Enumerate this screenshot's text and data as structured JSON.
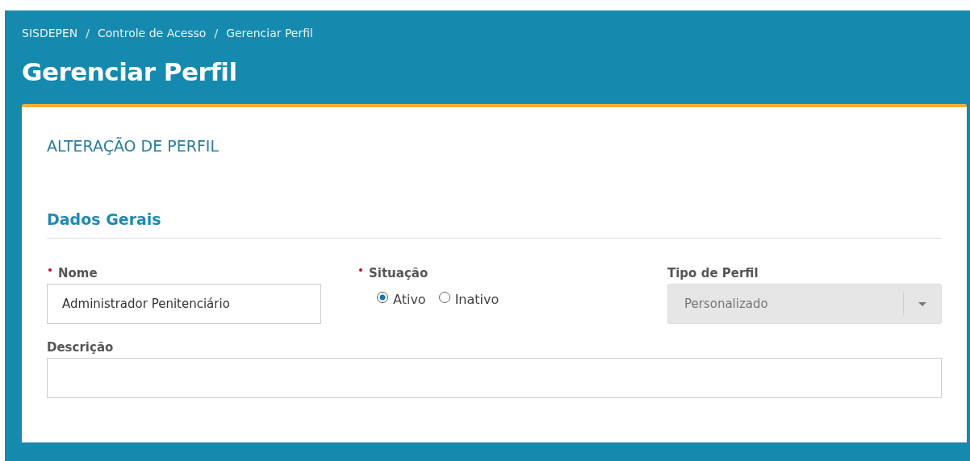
{
  "breadcrumbs": [
    "SISDEPEN",
    "Controle de Acesso",
    "Gerenciar Perfil"
  ],
  "breadcrumb_separator": "/",
  "title": "Gerenciar Perfil",
  "card": {
    "title": "ALTERAÇÃO DE PERFIL",
    "section": "Dados Gerais",
    "fields": [
      {
        "kind": "text",
        "label": "Nome",
        "required": true,
        "value": "Administrador Penitenciário"
      },
      {
        "kind": "radio",
        "label": "Situação",
        "required": true,
        "options": [
          {
            "label": "Ativo",
            "selected": true
          },
          {
            "label": "Inativo",
            "selected": false
          }
        ]
      },
      {
        "kind": "select",
        "label": "Tipo de Perfil",
        "required": false,
        "value": "Personalizado",
        "disabled": true
      },
      {
        "kind": "wide",
        "label": "Descrição",
        "required": false
      }
    ]
  }
}
